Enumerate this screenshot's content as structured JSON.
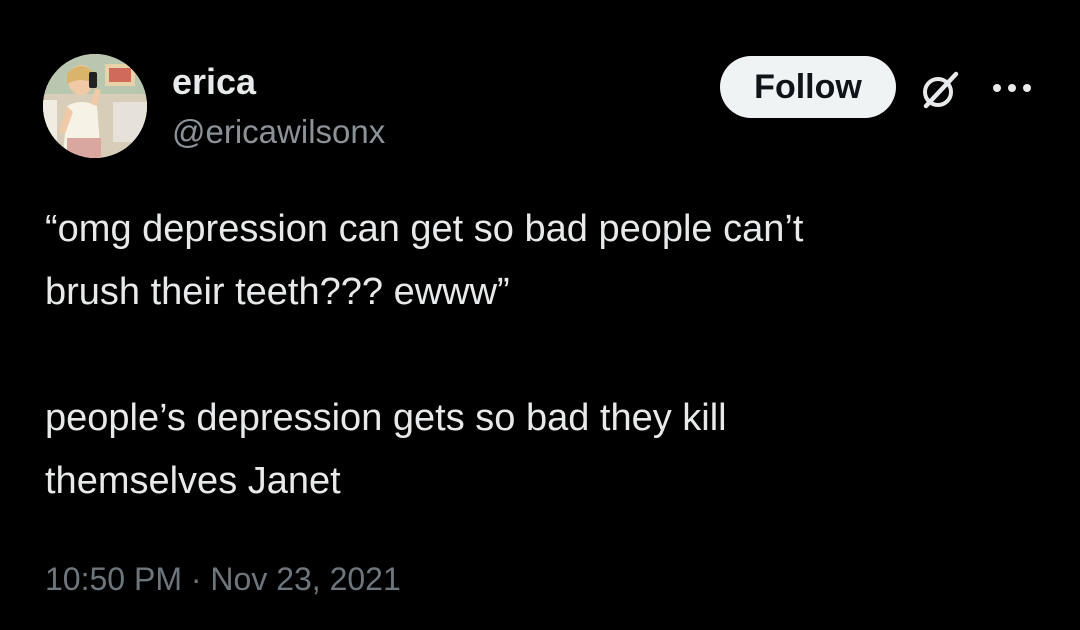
{
  "author": {
    "display_name": "erica",
    "handle": "@ericawilsonx",
    "avatar_icon": "profile-photo"
  },
  "header": {
    "follow_label": "Follow",
    "grok_icon": "slashed-circle-icon",
    "more_icon": "more-dots-icon"
  },
  "tweet": {
    "line1": "“omg depression can get so bad people can’t",
    "line2": "brush their teeth??? ewww”",
    "line3": "people’s depression gets so bad they kill",
    "line4": "themselves Janet"
  },
  "meta": {
    "timestamp": "10:50 PM · Nov 23, 2021"
  },
  "colors": {
    "background": "#000000",
    "text_primary": "#e7e9ea",
    "text_secondary": "#71767b",
    "button_bg": "#eff3f4",
    "button_text": "#0f1419"
  }
}
